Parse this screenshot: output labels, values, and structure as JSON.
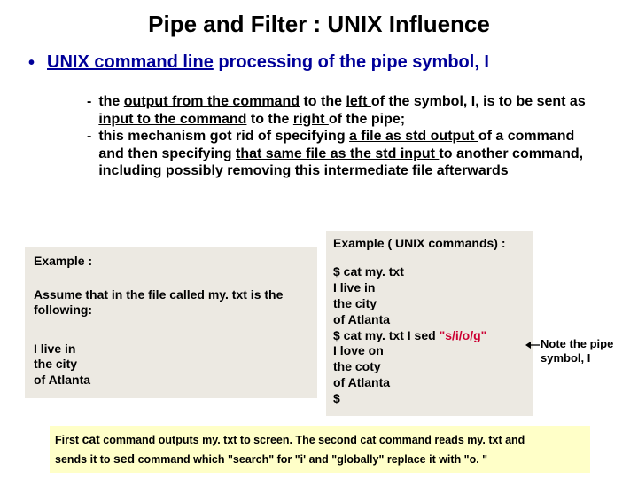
{
  "title": "Pipe and Filter : UNIX Influence",
  "bullet": {
    "underlined": "UNIX command line",
    "rest": " processing of the pipe symbol,  I"
  },
  "sub": {
    "p1a": "the ",
    "p1b": "output from the command",
    "p1c": " to the ",
    "p1d": "left ",
    "p1e": "of the symbol,",
    "p1f": " I, ",
    "p1g": "is to be sent as ",
    "p1h": "input to the command",
    "p1i": " to the ",
    "p1j": "right ",
    "p1k": "of the pipe;",
    "p2a": "this mechanism got rid of specifying ",
    "p2b": "a file as std output ",
    "p2c": "of a command and then specifying ",
    "p2d": "that same file as the std input ",
    "p2e": "to another command, including possibly ",
    "p2f": "removing this intermediate file afterwards"
  },
  "left": {
    "hdr": "Example :",
    "para": "Assume that in the file called my. txt is the following:",
    "l1": "I live in",
    "l2": "the city",
    "l3": "of Atlanta"
  },
  "right": {
    "hdr": "Example ( UNIX commands) :",
    "c1": "$ cat my. txt",
    "r1": "I live in",
    "r2": "the city",
    "r3": "of Atlanta",
    "c2a": "$ cat my. txt  I  sed ",
    "c2b": "\"s/i/o/g\"",
    "o1": "I love on",
    "o2": "the coty",
    "o3": "of Atlanta",
    "o4": " $"
  },
  "note": {
    "l1": "Note the pipe",
    "l2": "symbol,  I"
  },
  "caption": {
    "t1": "First ",
    "t2": "cat",
    "t3": " command outputs my. txt to screen. The second cat command reads my. txt and",
    "t4": "sends it to ",
    "t5": "sed",
    "t6": " command which \"search\" for \"i' and \"globally\" replace it with \"o. \""
  }
}
